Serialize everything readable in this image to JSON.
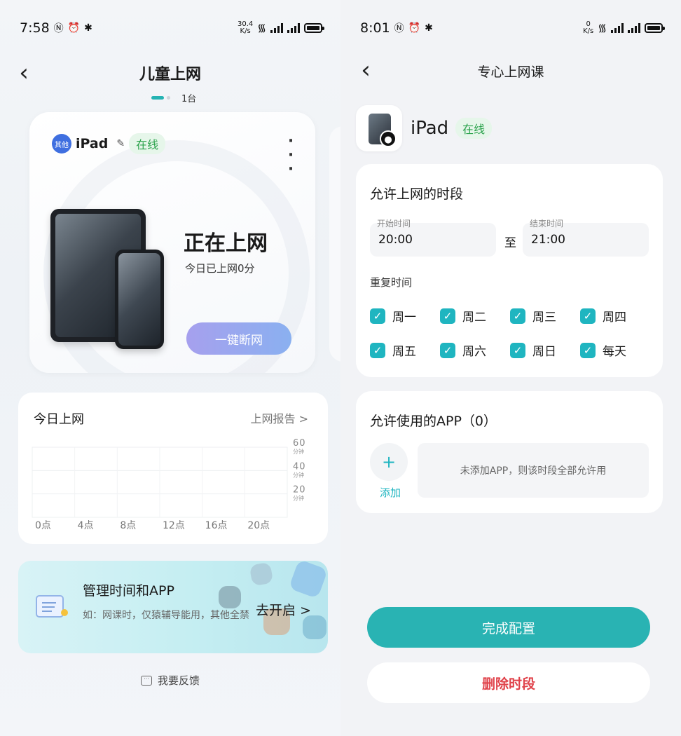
{
  "left": {
    "status": {
      "time": "7:58",
      "netspeed_value": "30.4",
      "netspeed_unit": "K/s"
    },
    "title": "儿童上网",
    "pager_count": "1台",
    "device": {
      "badge": "其他",
      "name": "iPad",
      "status": "在线"
    },
    "surfing_status": "正在上网",
    "today_duration": "今日已上网0分",
    "disconnect_label": "一键断网",
    "today": {
      "title": "今日上网",
      "report_link": "上网报告 >"
    },
    "promo": {
      "title": "管理时间和APP",
      "subtitle": "如：网课时，仅猿辅导能用，其他全禁",
      "action": "去开启 >"
    },
    "feedback": "我要反馈"
  },
  "right": {
    "status": {
      "time": "8:01",
      "netspeed_value": "0",
      "netspeed_unit": "K/s"
    },
    "title": "专心上网课",
    "device": {
      "name": "iPad",
      "status": "在线"
    },
    "time_section": {
      "title": "允许上网的时段",
      "start_label": "开始时间",
      "start_value": "20:00",
      "to_label": "至",
      "end_label": "结束时间",
      "end_value": "21:00",
      "repeat_title": "重复时间",
      "days": [
        "周一",
        "周二",
        "周三",
        "周四",
        "周五",
        "周六",
        "周日",
        "每天"
      ]
    },
    "app_section": {
      "title": "允许使用的APP（0）",
      "add_label": "添加",
      "empty_text": "未添加APP，则该时段全部允许用"
    },
    "done_label": "完成配置",
    "delete_label": "删除时段"
  },
  "chart_data": {
    "type": "bar",
    "categories": [
      "0点",
      "4点",
      "8点",
      "12点",
      "16点",
      "20点"
    ],
    "values": [
      0,
      0,
      0,
      0,
      0,
      0
    ],
    "y_ticks": [
      {
        "value": "20",
        "unit": "分钟"
      },
      {
        "value": "40",
        "unit": "分钟"
      },
      {
        "value": "60",
        "unit": "分钟"
      }
    ],
    "ylim": [
      0,
      60
    ],
    "grid": true
  },
  "colors": {
    "accent": "#29b3b3",
    "online": "#2aa24b",
    "danger": "#e0424a",
    "badge": "#3f6fe0"
  }
}
